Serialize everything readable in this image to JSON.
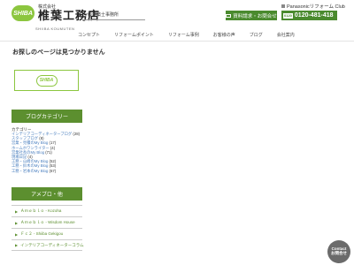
{
  "header": {
    "logo_badge": "SHIBA",
    "company_small": "株式会社",
    "company_name": "椎葉工務店",
    "company_romaji": "SHIIBA KOUMUTEN",
    "office_label": "一級建築士事務所",
    "panasonic_label": "Panasonicリフォーム Club",
    "contact_button": "資料請求・お問合せ",
    "phone_free": "0120",
    "phone_number": "0120-481-418"
  },
  "nav": {
    "items": [
      {
        "label": "コンセプト"
      },
      {
        "label": "リフォームポイント"
      },
      {
        "label": "リフォーム事例"
      },
      {
        "label": "お客様の声"
      },
      {
        "label": "ブログ"
      },
      {
        "label": "会社案内"
      }
    ]
  },
  "main": {
    "title": "お探しのページは見つかりません",
    "logo_box_text": "SHIBA"
  },
  "blog": {
    "heading": "ブログカテゴリー",
    "category_label": "カテゴリー",
    "categories": [
      {
        "name": "インテリアコーディネーターブログ",
        "count": "(28)"
      },
      {
        "name": "スタッフブログ",
        "count": "(8)"
      },
      {
        "name": "営業・見積のMy Blog",
        "count": "(17)"
      },
      {
        "name": "ホームホワンライター",
        "count": "(4)"
      },
      {
        "name": "営業社長のMy Blog",
        "count": "(71)"
      },
      {
        "name": "現場日記",
        "count": "(4)"
      },
      {
        "name": "工務・山崎のMy Blog",
        "count": "(52)"
      },
      {
        "name": "工務・鈴木のMy Blog",
        "count": "(53)"
      },
      {
        "name": "工務・岩本のMy Blog",
        "count": "(67)"
      }
    ]
  },
  "ameblo": {
    "heading": "アメブロ・他",
    "items": [
      {
        "label": "Ａｍｅｂｌｏ - Kozoha"
      },
      {
        "label": "Ａｍｅｂｌｏ - Wisdom House"
      },
      {
        "label": "Ｆｃ２ - Shiiba Gekigou"
      },
      {
        "label": "インテリアコーディネーターコラム"
      }
    ]
  },
  "float_contact": {
    "line1": "Contact",
    "line2": "お問合せ"
  }
}
